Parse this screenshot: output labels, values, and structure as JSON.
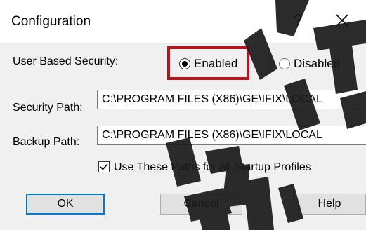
{
  "dialog": {
    "title": "Configuration",
    "help_label": "?"
  },
  "security": {
    "label": "User Based Security:",
    "options": [
      {
        "label": "Enabled",
        "selected": true
      },
      {
        "label": "Disabled",
        "selected": false
      }
    ]
  },
  "paths": {
    "security_label": "Security Path:",
    "security_value": "C:\\PROGRAM FILES (X86)\\GE\\IFIX\\LOCAL",
    "backup_label": "Backup Path:",
    "backup_value": "C:\\PROGRAM FILES (X86)\\GE\\IFIX\\LOCAL"
  },
  "checkbox": {
    "label": "Use These Paths for All Startup Profiles",
    "checked": true
  },
  "buttons": {
    "ok": "OK",
    "cancel": "Cancel",
    "help": "Help"
  },
  "colors": {
    "highlight": "#b8141c",
    "default_button_border": "#0078d7",
    "watermark": "#1a1a1a"
  }
}
